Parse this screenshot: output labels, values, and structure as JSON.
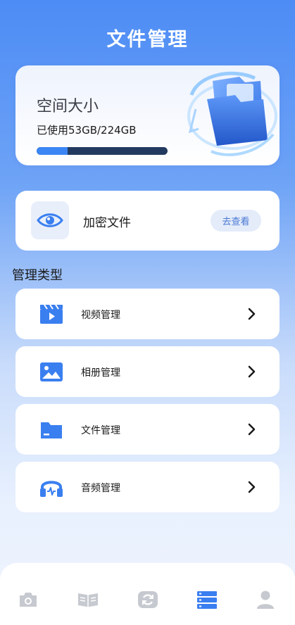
{
  "header": {
    "title": "文件管理"
  },
  "storage": {
    "title": "空间大小",
    "used_text": "已使用53GB/224GB",
    "used_fraction": 0.2366,
    "fill_color": "#3b86f4",
    "track_color": "#233a60",
    "illustration_icon": "folder-illustration-icon"
  },
  "secure": {
    "icon": "eye-icon",
    "label": "加密文件",
    "button_label": "去查看"
  },
  "section": {
    "title": "管理类型"
  },
  "menu": [
    {
      "icon": "video-clapper-icon",
      "label": "视频管理"
    },
    {
      "icon": "image-icon",
      "label": "相册管理"
    },
    {
      "icon": "folder-icon",
      "label": "文件管理"
    },
    {
      "icon": "headphones-icon",
      "label": "音频管理"
    }
  ],
  "tabs": [
    {
      "icon": "camera-icon",
      "active": false
    },
    {
      "icon": "book-icon",
      "active": false
    },
    {
      "icon": "refresh-icon",
      "active": false
    },
    {
      "icon": "storage-list-icon",
      "active": true
    },
    {
      "icon": "user-icon",
      "active": false
    }
  ],
  "colors": {
    "accent": "#3b86f4",
    "icon_blue": "#3a7ff0",
    "inactive_tab": "#c6c9cf"
  }
}
